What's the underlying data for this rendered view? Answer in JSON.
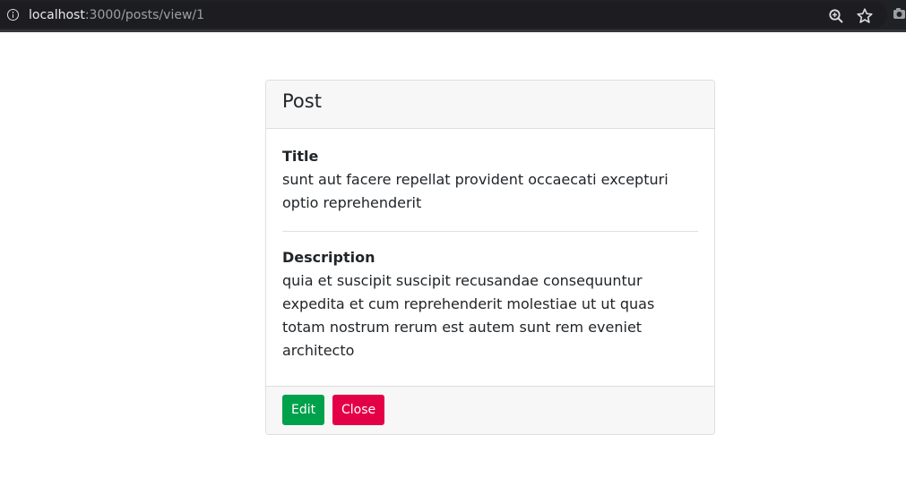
{
  "browser": {
    "url_host": "localhost",
    "url_path": ":3000/posts/view/1",
    "icons": [
      "info-icon",
      "zoom-icon",
      "star-icon",
      "extension-icon"
    ]
  },
  "card": {
    "header_title": "Post",
    "fields": [
      {
        "label": "Title",
        "value": "sunt aut facere repellat provident occaecati excepturi optio reprehenderit"
      },
      {
        "label": "Description",
        "value": "quia et suscipit suscipit recusandae consequuntur expedita et cum reprehenderit molestiae ut ut quas totam nostrum rerum est autem sunt rem eveniet architecto"
      }
    ],
    "buttons": {
      "edit_label": "Edit",
      "close_label": "Close"
    }
  },
  "colors": {
    "edit_button": "#00a14b",
    "close_button": "#e40046",
    "card_header_bg": "#f7f7f7",
    "browser_bar": "#202124"
  }
}
